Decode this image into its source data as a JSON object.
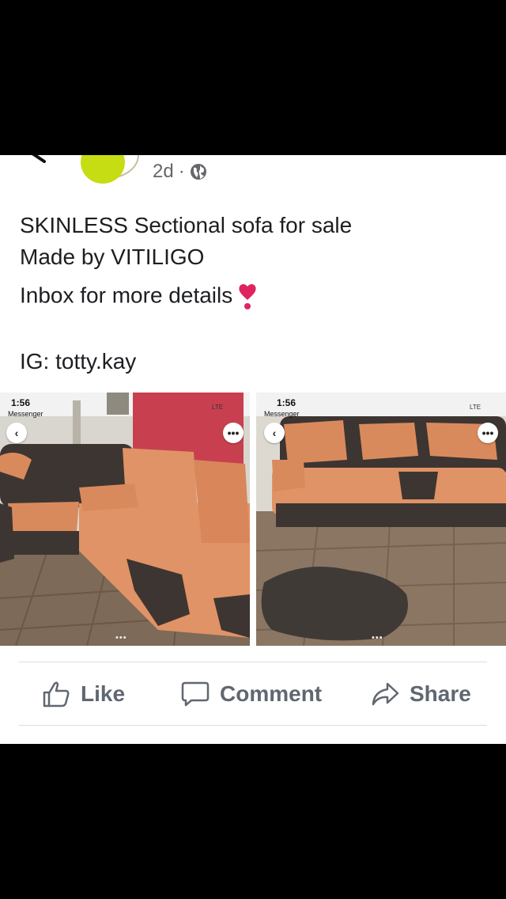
{
  "post": {
    "time": "2d",
    "separator": "·",
    "lines": [
      "SKINLESS Sectional sofa for sale",
      "Made by VITILIGO",
      "Inbox for more details",
      "IG: totty.kay"
    ]
  },
  "photos": [
    {
      "status_time": "1:56",
      "back_label": "Messenger",
      "network": "LTE"
    },
    {
      "status_time": "1:56",
      "back_label": "Messenger",
      "network": "LTE"
    }
  ],
  "actions": {
    "like": "Like",
    "comment": "Comment",
    "share": "Share"
  },
  "colors": {
    "avatar": "#c5dd12",
    "action_text": "#606770",
    "heart": "#e0245e"
  }
}
